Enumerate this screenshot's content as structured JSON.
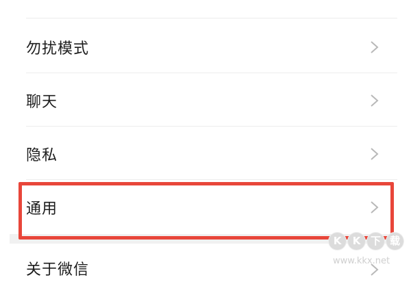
{
  "settings": {
    "items": [
      {
        "label": "勿扰模式"
      },
      {
        "label": "聊天"
      },
      {
        "label": "隐私"
      },
      {
        "label": "通用",
        "highlighted": true
      },
      {
        "label": "关于微信"
      }
    ]
  },
  "watermark": {
    "logo_chars": [
      "K",
      "K",
      "下",
      "载"
    ],
    "url": "www.kkx.net"
  },
  "colors": {
    "highlight": "#e8463a",
    "chevron": "#b8b8b8",
    "divider": "#ececec",
    "text": "#1d1d1d"
  },
  "icons": {
    "row_arrow": "chevron-right-icon"
  }
}
